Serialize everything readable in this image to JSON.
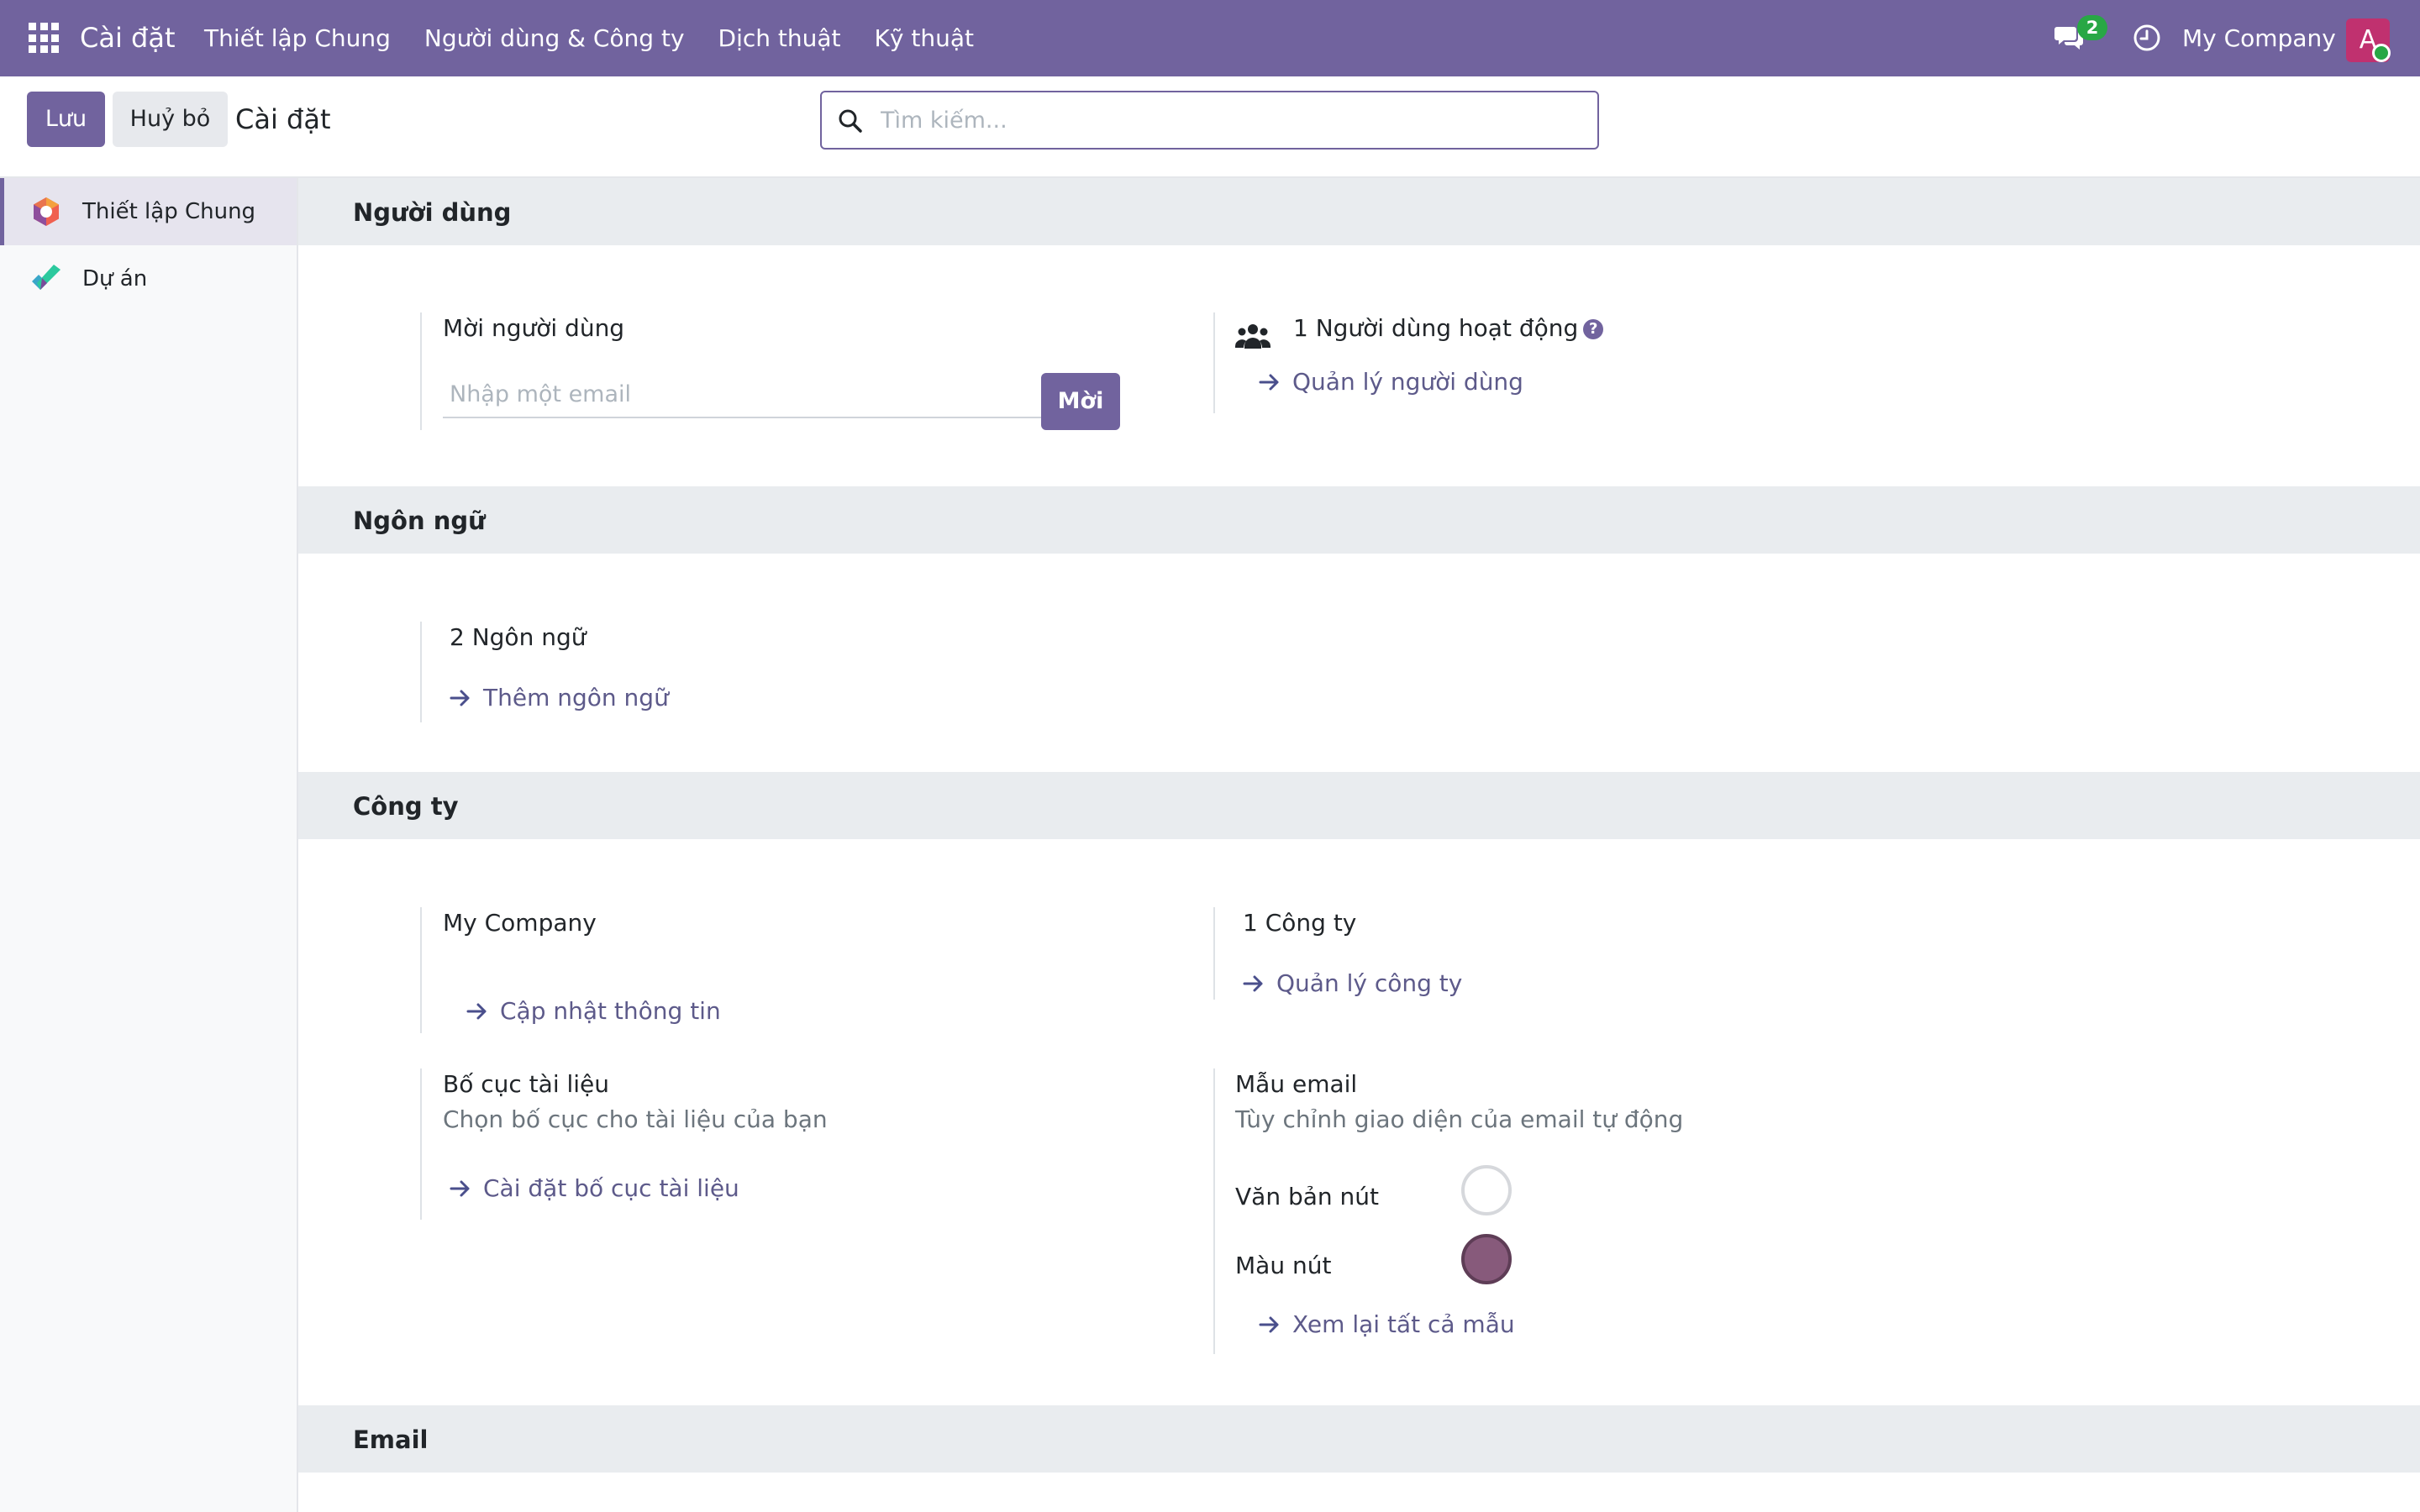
{
  "navbar": {
    "brand": "Cài đặt",
    "menu": [
      "Thiết lập Chung",
      "Người dùng & Công ty",
      "Dịch thuật",
      "Kỹ thuật"
    ],
    "chat_badge": "2",
    "company": "My Company",
    "avatar_initial": "A",
    "colors": {
      "bar": "#71639e",
      "badge": "#28a745",
      "avatar": "#c0316f"
    }
  },
  "control": {
    "save_label": "Lưu",
    "discard_label": "Huỷ bỏ",
    "breadcrumb": "Cài đặt",
    "search_placeholder": "Tìm kiếm..."
  },
  "sidebar": {
    "items": [
      {
        "label": "Thiết lập Chung",
        "icon": "settings-app-icon",
        "active": true
      },
      {
        "label": "Dự án",
        "icon": "project-app-icon",
        "active": false
      }
    ]
  },
  "sections": {
    "users": {
      "title": "Người dùng",
      "invite_title": "Mời người dùng",
      "email_placeholder": "Nhập một email",
      "invite_button": "Mời",
      "active_users": "1 Người dùng hoạt động",
      "manage_users": "Quản lý người dùng"
    },
    "languages": {
      "title": "Ngôn ngữ",
      "count": "2 Ngôn ngữ",
      "add_language": "Thêm ngôn ngữ"
    },
    "companies": {
      "title": "Công ty",
      "company_name": "My Company",
      "update_info": "Cập nhật thông tin",
      "count": "1 Công ty",
      "manage_companies": "Quản lý công ty",
      "layout_title": "Bố cục tài liệu",
      "layout_desc": "Chọn bố cục cho tài liệu của bạn",
      "layout_link": "Cài đặt bố cục tài liệu",
      "email_template_title": "Mẫu email",
      "email_template_desc": "Tùy chỉnh giao diện của email tự động",
      "button_text_label": "Văn bản nút",
      "button_text_color": "#ffffff",
      "button_color_label": "Màu nút",
      "button_color": "#875a7b",
      "review_templates": "Xem lại tất cả mẫu"
    },
    "email": {
      "title": "Email"
    }
  }
}
